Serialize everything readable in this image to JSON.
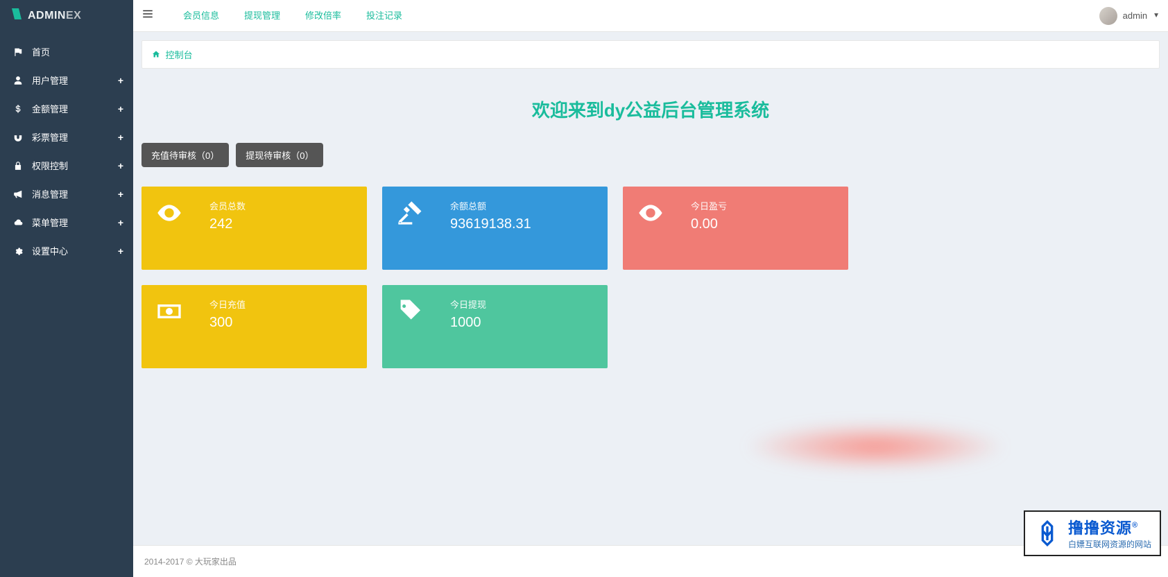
{
  "brand": {
    "prefix": "ADMIN",
    "suffix": "EX"
  },
  "sidebar": {
    "items": [
      {
        "icon": "flag",
        "label": "首页",
        "expand": false
      },
      {
        "icon": "user",
        "label": "用户管理",
        "expand": true
      },
      {
        "icon": "dollar",
        "label": "金额管理",
        "expand": true
      },
      {
        "icon": "magnet",
        "label": "彩票管理",
        "expand": true
      },
      {
        "icon": "lock",
        "label": "权限控制",
        "expand": true
      },
      {
        "icon": "bullhorn",
        "label": "消息管理",
        "expand": true
      },
      {
        "icon": "cloud",
        "label": "菜单管理",
        "expand": true
      },
      {
        "icon": "gear",
        "label": "设置中心",
        "expand": true
      }
    ]
  },
  "header": {
    "nav": [
      "会员信息",
      "提现管理",
      "修改倍率",
      "投注记录"
    ],
    "user": "admin"
  },
  "breadcrumb": "控制台",
  "welcome": "欢迎来到dy公益后台管理系统",
  "pills": [
    "充值待审核（0）",
    "提现待审核（0）"
  ],
  "cards": [
    {
      "color": "yellow",
      "icon": "eye",
      "label": "会员总数",
      "value": "242"
    },
    {
      "color": "blue",
      "icon": "gavel",
      "label": "余额总额",
      "value": "93619138.31"
    },
    {
      "color": "red",
      "icon": "eye",
      "label": "今日盈亏",
      "value": "0.00"
    },
    {
      "color": "yellow",
      "icon": "money",
      "label": "今日充值",
      "value": "300"
    },
    {
      "color": "green",
      "icon": "tag",
      "label": "今日提现",
      "value": "1000"
    }
  ],
  "footer": "2014-2017 © 大玩家出品",
  "watermark": {
    "main": "撸撸资源",
    "sub": "白嫖互联网资源的网站"
  }
}
